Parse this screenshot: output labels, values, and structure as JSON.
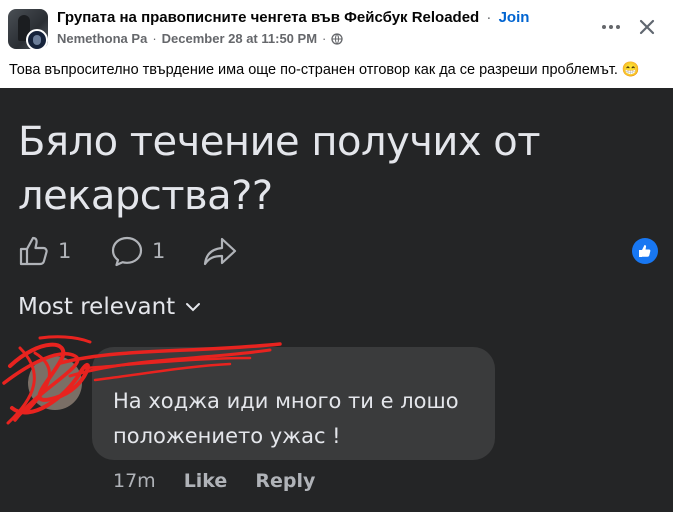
{
  "post": {
    "group_name": "Групата на правописните ченгета във Фейсбук Reloaded",
    "dot": "·",
    "join_label": "Join",
    "author": "Nemethona Pa",
    "date": "December 28 at 11:50 PM",
    "text": "Това въпросително твърдение има още по-странен отговор как да се разреши проблемът. 😁"
  },
  "image": {
    "headline": "Бяло течение получих от лекарства??",
    "like_count": "1",
    "comment_count": "1",
    "sort_label": "Most relevant",
    "comment": {
      "name": "",
      "text": "На ходжа иди много ти е лошо положението ужас !",
      "time": "17m",
      "like_label": "Like",
      "reply_label": "Reply"
    }
  },
  "colors": {
    "accent": "#0064d1",
    "dark_bg": "#242526",
    "bubble": "#3a3b3c",
    "like_blue": "#1877f2",
    "scribble": "#e8231f"
  }
}
